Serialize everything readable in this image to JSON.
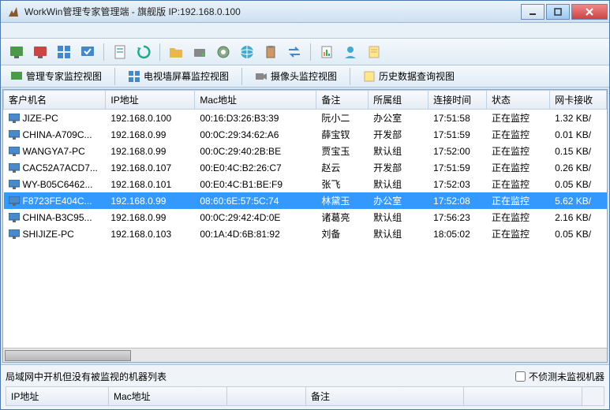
{
  "title": "WorkWin管理专家管理端 - 旗舰版 IP:192.168.0.100",
  "toolbar2": {
    "items": [
      {
        "label": "管理专家监控视图"
      },
      {
        "label": "电视墙屏幕监控视图"
      },
      {
        "label": "摄像头监控视图"
      },
      {
        "label": "历史数据查询视图"
      }
    ]
  },
  "columns": [
    "客户机名",
    "IP地址",
    "Mac地址",
    "备注",
    "所属组",
    "连接时间",
    "状态",
    "网卡接收"
  ],
  "rows": [
    {
      "name": "JIZE-PC",
      "ip": "192.168.0.100",
      "mac": "00:16:D3:26:B3:39",
      "note": "阮小二",
      "group": "办公室",
      "time": "17:51:58",
      "status": "正在监控",
      "net": "1.32 KB/",
      "selected": false
    },
    {
      "name": "CHINA-A709C...",
      "ip": "192.168.0.99",
      "mac": "00:0C:29:34:62:A6",
      "note": "薛宝钗",
      "group": "开发部",
      "time": "17:51:59",
      "status": "正在监控",
      "net": "0.01 KB/",
      "selected": false
    },
    {
      "name": "WANGYA7-PC",
      "ip": "192.168.0.99",
      "mac": "00:0C:29:40:2B:BE",
      "note": "贾宝玉",
      "group": "默认组",
      "time": "17:52:00",
      "status": "正在监控",
      "net": "0.15 KB/",
      "selected": false
    },
    {
      "name": "CAC52A7ACD7...",
      "ip": "192.168.0.107",
      "mac": "00:E0:4C:B2:26:C7",
      "note": "赵云",
      "group": "开发部",
      "time": "17:51:59",
      "status": "正在监控",
      "net": "0.26 KB/",
      "selected": false
    },
    {
      "name": "WY-B05C6462...",
      "ip": "192.168.0.101",
      "mac": "00:E0:4C:B1:BE:F9",
      "note": "张飞",
      "group": "默认组",
      "time": "17:52:03",
      "status": "正在监控",
      "net": "0.05 KB/",
      "selected": false
    },
    {
      "name": "F8723FE404C...",
      "ip": "192.168.0.99",
      "mac": "08:60:6E:57:5C:74",
      "note": "林黛玉",
      "group": "办公室",
      "time": "17:52:08",
      "status": "正在监控",
      "net": "5.62 KB/",
      "selected": true
    },
    {
      "name": "CHINA-B3C95...",
      "ip": "192.168.0.99",
      "mac": "00:0C:29:42:4D:0E",
      "note": "诸葛亮",
      "group": "默认组",
      "time": "17:56:23",
      "status": "正在监控",
      "net": "2.16 KB/",
      "selected": false
    },
    {
      "name": "SHIJIZE-PC",
      "ip": "192.168.0.103",
      "mac": "00:1A:4D:6B:81:92",
      "note": "刘备",
      "group": "默认组",
      "time": "18:05:02",
      "status": "正在监控",
      "net": "0.05 KB/",
      "selected": false
    }
  ],
  "bottom": {
    "title": "局域网中开机但没有被监视的机器列表",
    "checkbox": "不侦测未监视机器",
    "cols": [
      "IP地址",
      "Mac地址",
      "",
      "备注",
      ""
    ]
  }
}
